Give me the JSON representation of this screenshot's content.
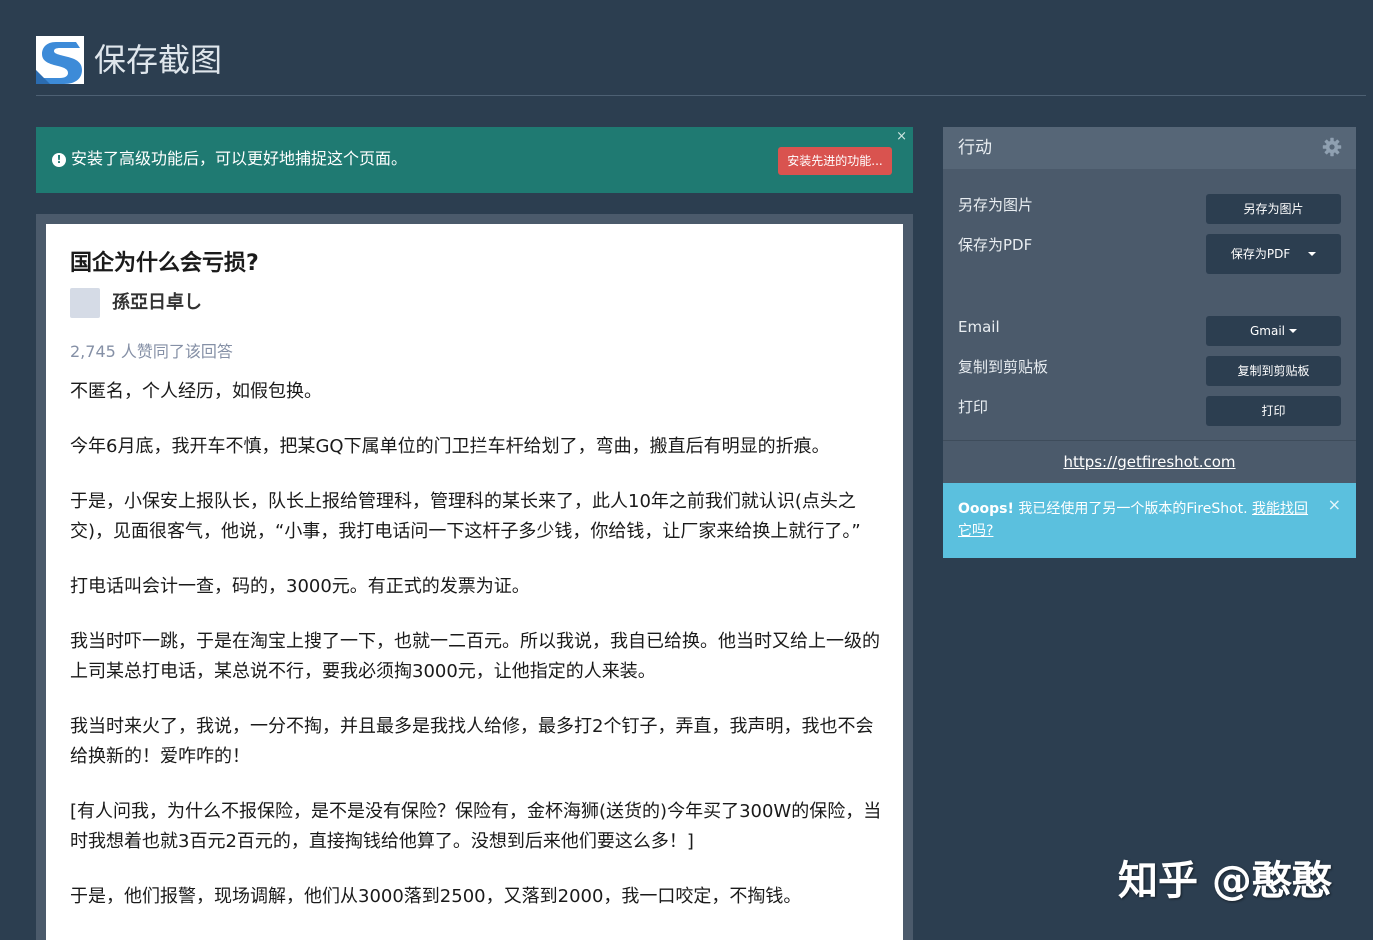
{
  "header": {
    "title": "保存截图"
  },
  "alert": {
    "message": "安装了高级功能后，可以更好地捕捉这个页面。",
    "button_label": "安装先进的功能...",
    "close_label": "×"
  },
  "preview": {
    "question_title": "国企为什么会亏损?",
    "author_name": "孫亞日卓し",
    "votes": "2,745 人赞同了该回答",
    "paragraphs": [
      "不匿名，个人经历，如假包换。",
      "今年6月底，我开车不慎，把某GQ下属单位的门卫拦车杆给划了，弯曲，搬直后有明显的折痕。",
      "于是，小保安上报队长，队长上报给管理科，管理科的某长来了，此人10年之前我们就认识(点头之交)，见面很客气，他说，“小事，我打电话问一下这杆子多少钱，你给钱，让厂家来给换上就行了。”",
      "打电话叫会计一查，码的，3000元。有正式的发票为证。",
      "我当时吓一跳，于是在淘宝上搜了一下，也就一二百元。所以我说，我自已给换。他当时又给上一级的上司某总打电话，某总说不行，要我必须掏3000元，让他指定的人来装。",
      "我当时来火了，我说，一分不掏，并且最多是我找人给修，最多打2个钉子，弄直，我声明，我也不会给换新的！爱咋咋的！",
      "[有人问我，为什么不报保险，是不是没有保险？保险有，金杯海狮(送货的)今年买了300W的保险，当时我想着也就3百元2百元的，直接掏钱给他算了。没想到后来他们要这么多！]",
      "于是，他们报警，现场调解，他们从3000落到2500，又落到2000，我一口咬定，不掏钱。"
    ]
  },
  "panel": {
    "title": "行动",
    "rows": [
      {
        "label": "另存为图片",
        "button": "另存为图片"
      },
      {
        "label": "保存为PDF",
        "button": "保存为PDF"
      },
      {
        "label": "Email",
        "button": "Gmail"
      },
      {
        "label": "复制到剪贴板",
        "button": "复制到剪贴板"
      },
      {
        "label": "打印",
        "button": "打印"
      }
    ],
    "link": "https://getfireshot.com",
    "info": {
      "bold": "Ooops!",
      "text": " 我已经使用了另一个版本的FireShot. ",
      "link": "我能找回它吗?",
      "close_label": "×"
    }
  },
  "watermark": "知乎 @憨憨",
  "colors": {
    "background": "#2c3e50",
    "alert": "#1f7a72",
    "danger": "#d9534f",
    "info": "#5bc0de"
  },
  "icons": [
    "fireshot-logo-icon",
    "exclamation-circle-icon",
    "gear-icon",
    "caret-down-icon",
    "close-icon"
  ]
}
